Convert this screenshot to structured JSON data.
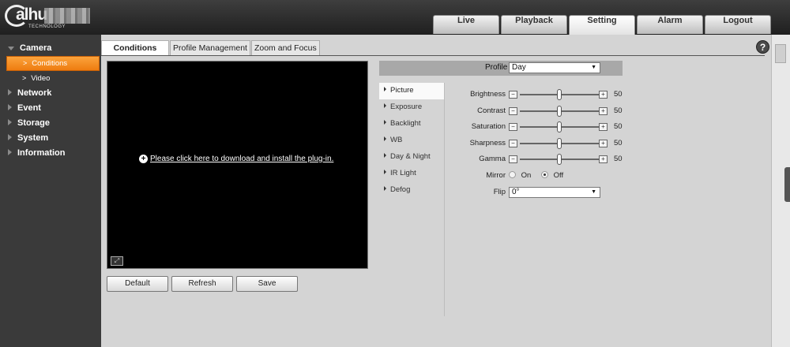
{
  "header": {
    "logo_text": "alhu",
    "logo_subtext": "TECHNOLOGY",
    "tabs": [
      "Live",
      "Playback",
      "Setting",
      "Alarm",
      "Logout"
    ],
    "active_tab": "Setting"
  },
  "sidebar": {
    "categories": [
      {
        "label": "Camera",
        "open": true
      },
      {
        "label": "Network"
      },
      {
        "label": "Event"
      },
      {
        "label": "Storage"
      },
      {
        "label": "System"
      },
      {
        "label": "Information"
      }
    ],
    "camera_items": [
      {
        "label": "Conditions",
        "active": true
      },
      {
        "label": "Video"
      }
    ]
  },
  "content": {
    "tabs": [
      "Conditions",
      "Profile Management",
      "Zoom and Focus"
    ],
    "active_tab": "Conditions",
    "help_icon": "?",
    "video": {
      "plugin_link": "Please click here to download and install the plug-in."
    },
    "buttons": {
      "default": "Default",
      "refresh": "Refresh",
      "save": "Save"
    },
    "profile": {
      "label": "Profile",
      "value": "Day"
    },
    "setting_tabs": [
      "Picture",
      "Exposure",
      "Backlight",
      "WB",
      "Day & Night",
      "IR Light",
      "Defog"
    ],
    "active_setting_tab": "Picture",
    "sliders": [
      {
        "label": "Brightness",
        "value": 50
      },
      {
        "label": "Contrast",
        "value": 50
      },
      {
        "label": "Saturation",
        "value": 50
      },
      {
        "label": "Sharpness",
        "value": 50
      },
      {
        "label": "Gamma",
        "value": 50
      }
    ],
    "mirror": {
      "label": "Mirror",
      "on": "On",
      "off": "Off",
      "selected": "Off"
    },
    "flip": {
      "label": "Flip",
      "value": "0°"
    }
  },
  "colors": {
    "accent": "#f08a1c",
    "header_bg": "#2a2a2a",
    "sidebar_bg": "#3a3a3a",
    "panel_bg": "#d4d4d4"
  }
}
